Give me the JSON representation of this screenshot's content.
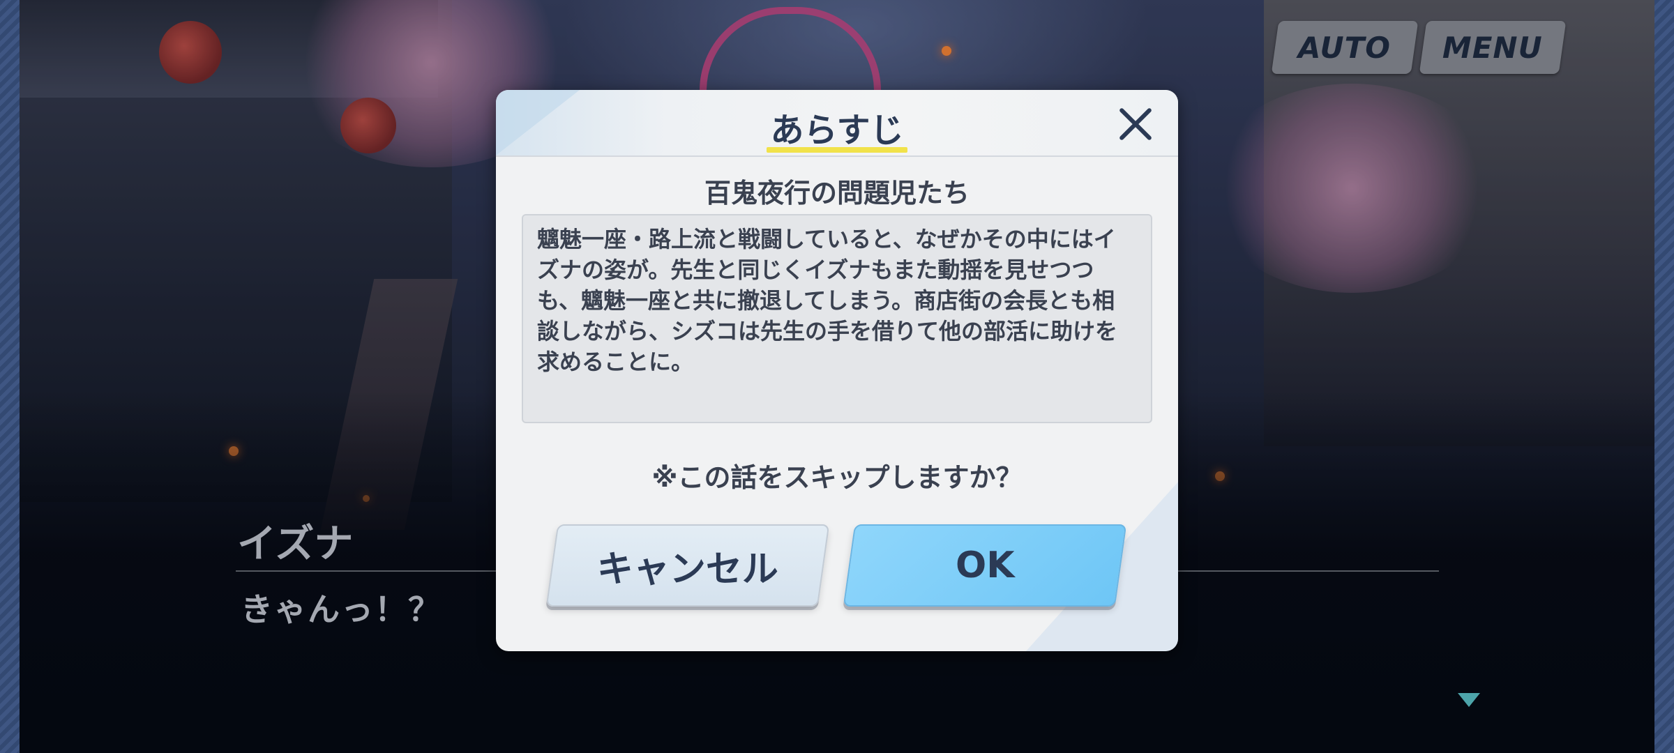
{
  "hud": {
    "auto_label": "AUTO",
    "menu_label": "MENU"
  },
  "dialogue": {
    "speaker": "イズナ",
    "text": "きゃんっ！？"
  },
  "modal": {
    "title": "あらすじ",
    "episode_title": "百鬼夜行の問題児たち",
    "synopsis": "魑魅一座・路上流と戦闘していると、なぜかその中にはイズナの姿が。先生と同じくイズナもまた動揺を見せつつも、魑魅一座と共に撤退してしまう。商店街の会長とも相談しながら、シズコは先生の手を借りて他の部活に助けを求めることに。",
    "skip_question": "※この話をスキップしますか？",
    "cancel_label": "キャンセル",
    "ok_label": "OK"
  },
  "colors": {
    "accent": "#6ec6f6",
    "text_dark": "#2b3a55",
    "title_underline": "#f1e24a"
  }
}
